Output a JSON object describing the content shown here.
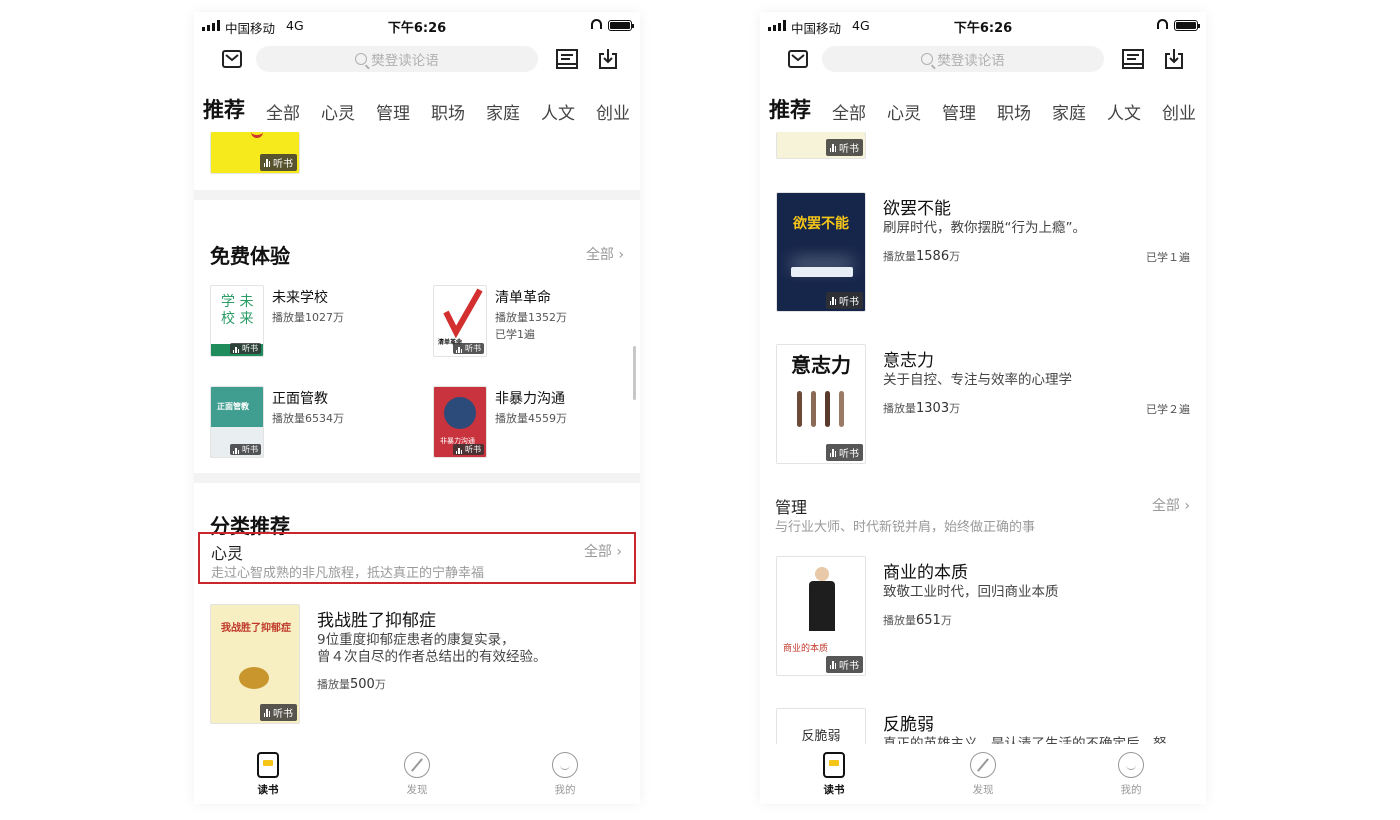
{
  "status": {
    "carrier": "中国移动",
    "network": "4G",
    "time": "下午6:26"
  },
  "search": {
    "placeholder": "樊登读论语"
  },
  "tabs": [
    "推荐",
    "全部",
    "心灵",
    "管理",
    "职场",
    "家庭",
    "人文",
    "创业"
  ],
  "listen_label": "听书",
  "left": {
    "free_section": {
      "title": "免费体验",
      "all": "全部 ›",
      "items": [
        {
          "title": "未来学校",
          "plays": "播放量1027万",
          "cover_text": "学 未\n校 来"
        },
        {
          "title": "清单革命",
          "plays": "播放量1352万",
          "studied": "已学1遍",
          "cover_text": "清单革命"
        },
        {
          "title": "正面管教",
          "plays": "播放量6534万",
          "cover_text": "正面管教"
        },
        {
          "title": "非暴力沟通",
          "plays": "播放量4559万",
          "cover_text": "非暴力沟通"
        }
      ]
    },
    "category_section": {
      "title": "分类推荐",
      "category": {
        "name": "心灵",
        "desc": "走过心智成熟的非凡旅程，抵达真正的宁静幸福",
        "all": "全部 ›"
      },
      "book": {
        "title": "我战胜了抑郁症",
        "desc1": "9位重度抑郁症患者的康复实录，",
        "desc2": "曾４次自尽的作者总结出的有效经验。",
        "plays_prefix": "播放量",
        "plays_num": "500",
        "plays_unit": "万",
        "cover_text": "我战胜了抑郁症"
      }
    }
  },
  "right": {
    "books_top": [
      {
        "title": "欲罢不能",
        "desc": "刷屏时代，教你摆脱“行为上瘾”。",
        "plays_prefix": "播放量",
        "plays_num": "1586",
        "plays_unit": "万",
        "studied": "已学１遍",
        "cover_text": "欲罢不能"
      },
      {
        "title": "意志力",
        "desc": "关于自控、专注与效率的心理学",
        "plays_prefix": "播放量",
        "plays_num": "1303",
        "plays_unit": "万",
        "studied": "已学２遍",
        "cover_text": "意志力"
      }
    ],
    "category": {
      "name": "管理",
      "desc": "与行业大师、时代新锐并肩，始终做正确的事",
      "all": "全部 ›"
    },
    "books_bottom": [
      {
        "title": "商业的本质",
        "desc": "致敬工业时代，回归商业本质",
        "plays_prefix": "播放量",
        "plays_num": "651",
        "plays_unit": "万",
        "cover_text": "商业的本质"
      },
      {
        "title": "反脆弱",
        "desc": "真正的英雄主义，是认清了生活的不确定后，努",
        "cover_text": "反脆弱"
      }
    ]
  },
  "tabbar": [
    {
      "label": "读书",
      "icon": "book-icon"
    },
    {
      "label": "发现",
      "icon": "compass-icon"
    },
    {
      "label": "我的",
      "icon": "profile-icon"
    }
  ],
  "colors": {
    "accent": "#f5c518",
    "highlight_border": "#c8272d"
  }
}
